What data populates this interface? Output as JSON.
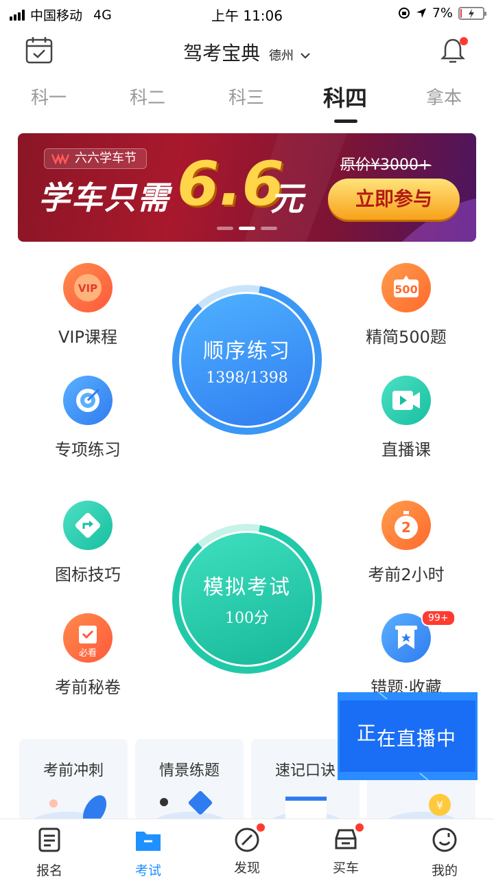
{
  "status_bar": {
    "carrier": "中国移动",
    "network": "4G",
    "time": "上午 11:06",
    "battery": "7%"
  },
  "header": {
    "title": "驾考宝典",
    "city": "德州"
  },
  "tabs": [
    "科一",
    "科二",
    "科三",
    "科四",
    "拿本"
  ],
  "active_tab": "科四",
  "banner": {
    "tag": "六六学车节",
    "headline": "学车只需",
    "amount": "6.6",
    "unit": "元",
    "original_price": "原价¥3000+",
    "cta": "立即参与",
    "slides": 3,
    "active_slide": 2
  },
  "grid": {
    "vip": "VIP课程",
    "jingjian": "精简500题",
    "zhuanxiang": "专项练习",
    "zhibo": "直播课",
    "tubiao": "图标技巧",
    "kaoqian2": "考前2小时",
    "mijuan": "考前秘卷",
    "cuoti": "错题·收藏",
    "mijuan_badge": "必看",
    "cuoti_badge": "99+"
  },
  "shunxu": {
    "label": "顺序练习",
    "progress": "1398/1398"
  },
  "moni": {
    "label": "模拟考试",
    "score": "100分"
  },
  "cards": [
    "考前冲刺",
    "情景练题",
    "速记口诀"
  ],
  "live_popup": {
    "first": "正",
    "rest": "在直播中"
  },
  "nav": [
    {
      "label": "报名"
    },
    {
      "label": "考试"
    },
    {
      "label": "发现"
    },
    {
      "label": "买车"
    },
    {
      "label": "我的"
    }
  ],
  "colors": {
    "accent": "#1e90ff",
    "badge": "#ff3b30",
    "practice_blue": "#3a8bf5",
    "exam_teal": "#22c9a8"
  }
}
